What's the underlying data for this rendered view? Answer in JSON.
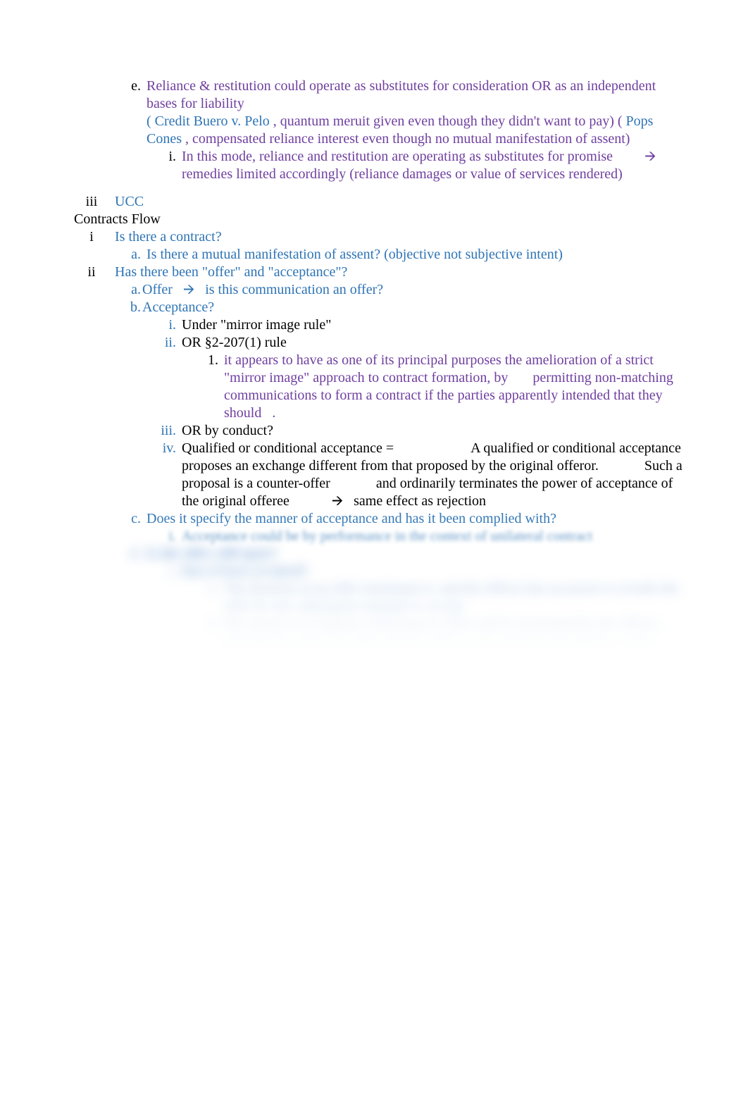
{
  "e": {
    "marker": "e.",
    "line1": "Reliance & restitution could operate as substitutes for consideration OR as an independent bases for liability",
    "case1_open": "( Credit Buero v. Pelo",
    "case1_rest": ",  quantum meruit given even though they didn't want to pay) (",
    "case2": "Pops Cones",
    "case2_rest": ", compensated reliance interest even though no mutual manifestation of assent)",
    "sub_i_marker": "i.",
    "sub_i_a": "In this mode, reliance and restitution are operating as substitutes for promise",
    "sub_i_b": "remedies limited accordingly (reliance damages or value of services rendered)"
  },
  "iii": {
    "marker": "iii",
    "text": "UCC"
  },
  "heading": "Contracts Flow",
  "i": {
    "marker": "i",
    "text": "Is there a contract?"
  },
  "i_a": {
    "marker": "a.",
    "text": "Is there a mutual manifestation of assent? (objective not subjective intent)"
  },
  "ii": {
    "marker": "ii",
    "text": "Has there been \"offer\" and \"acceptance\"?"
  },
  "ii_a": {
    "marker": "a.",
    "label": "Offer",
    "tail": "is this communication an offer?"
  },
  "ii_b": {
    "marker": "b.",
    "text": "Acceptance?"
  },
  "ii_b_i": {
    "marker": "i.",
    "text": "Under \"mirror image rule\""
  },
  "ii_b_ii": {
    "marker": "ii.",
    "text": "OR §2-207(1) rule"
  },
  "ii_b_ii_1": {
    "marker": "1.",
    "a": "it appears to have as one of its principal purposes the amelioration of a strict \"mirror image\" approach to contract formation, by",
    "b": "permitting non-matching communications to form a contract if the parties apparently intended that they should",
    "c": "."
  },
  "ii_b_iii": {
    "marker": "iii.",
    "text": "OR by conduct?"
  },
  "ii_b_iv": {
    "marker": "iv.",
    "lead": "Qualified or conditional acceptance =",
    "mid1": "A qualified or conditional acceptance proposes an exchange different from that proposed by the original offeror.",
    "mid2": "Such a proposal is a counter-offer",
    "mid3": "and ordinarily terminates the power of acceptance of the original offeree",
    "tail": "same effect as rejection"
  },
  "ii_c": {
    "marker": "c.",
    "text": "Does it specify the manner of acceptance and has it been complied with?"
  },
  "blur": {
    "c_i_marker": "i.",
    "c_i": "Acceptance could be by performance in the context of unilateral contract",
    "d_marker": "d.",
    "d": "Is the offer still open?",
    "d_i_marker": "i.",
    "d_i": "Has it been revoked?",
    "d_i_1_marker": "1.",
    "d_i_1": "The duration of an offer terminates it, and the offeror has no power to revoke the offer by any subsequent attempts to accept",
    "d_i_2_marker": "2.",
    "d_i_2": "The power of acceptance following an offer will be terminated by the offeror, typically by will or by other means, such as revocation by the offeror, or his death or incapacity"
  }
}
